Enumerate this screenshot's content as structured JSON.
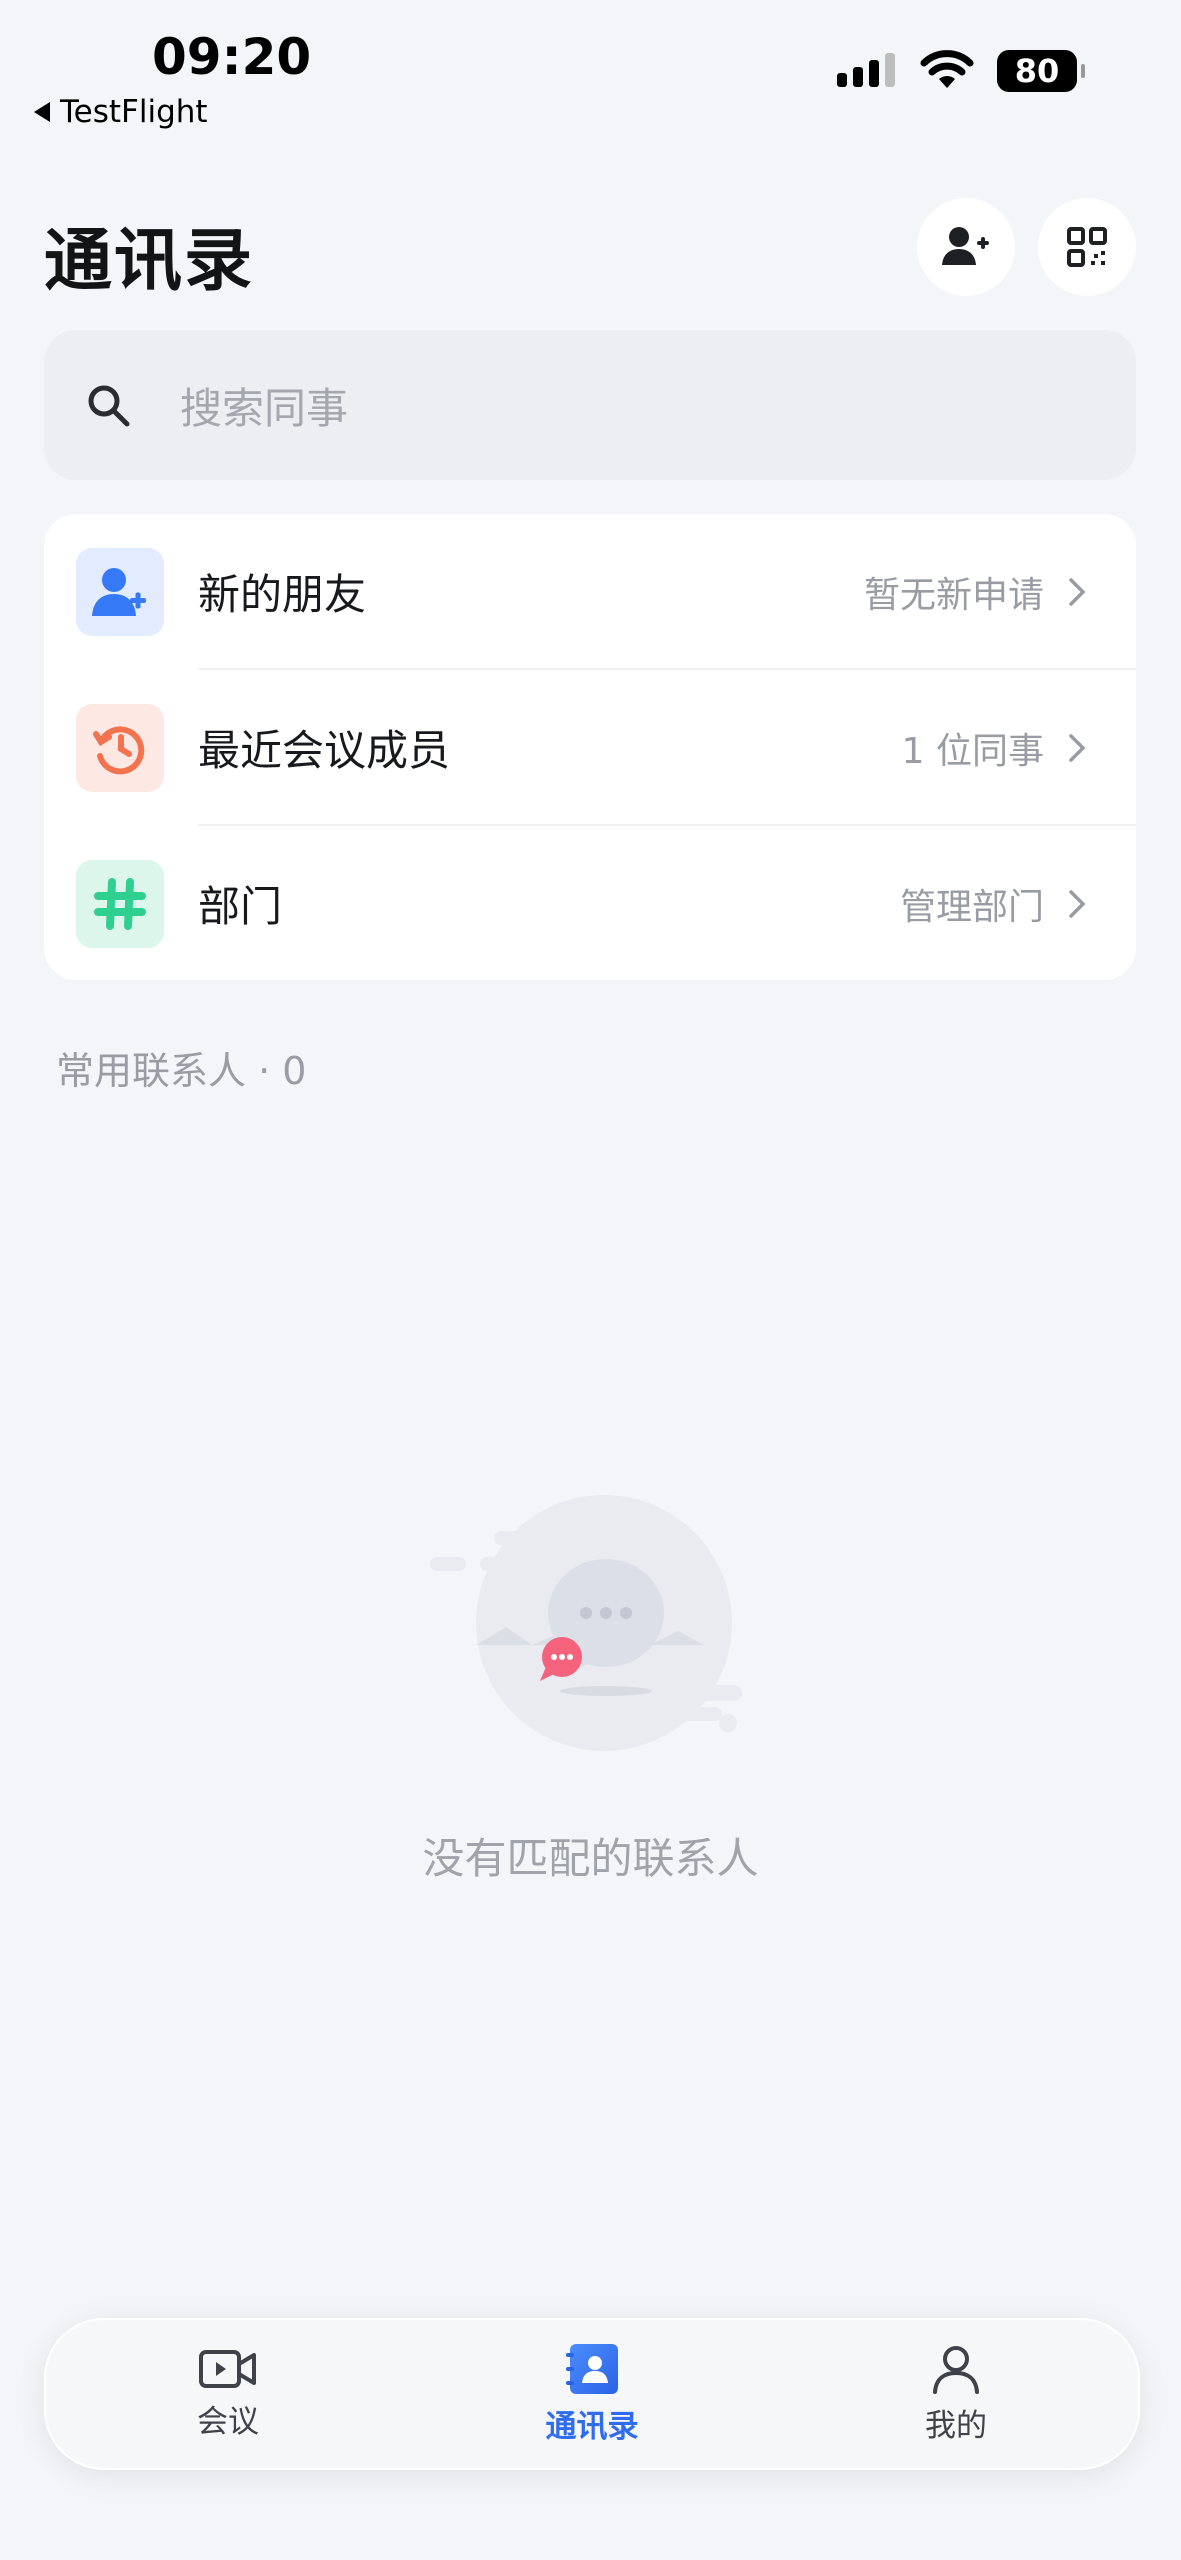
{
  "status_bar": {
    "time": "09:20",
    "back_app": "TestFlight",
    "battery": "80"
  },
  "header": {
    "title": "通讯录"
  },
  "search": {
    "placeholder": "搜索同事"
  },
  "menu": {
    "items": [
      {
        "label": "新的朋友",
        "detail": "暂无新申请",
        "icon": "add-friend-icon",
        "color": "#3579f6"
      },
      {
        "label": "最近会议成员",
        "detail": "1 位同事",
        "icon": "history-clock-icon",
        "color": "#f2734e"
      },
      {
        "label": "部门",
        "detail": "管理部门",
        "icon": "hashtag-icon",
        "color": "#2fcf91"
      }
    ]
  },
  "favorites": {
    "label": "常用联系人 · 0"
  },
  "empty_state": {
    "message": "没有匹配的联系人"
  },
  "tab_bar": {
    "tabs": [
      {
        "label": "会议",
        "icon": "video-camera-icon",
        "active": false
      },
      {
        "label": "通讯录",
        "icon": "contacts-book-icon",
        "active": true
      },
      {
        "label": "我的",
        "icon": "person-icon",
        "active": false
      }
    ],
    "active_color": "#2f6cf0"
  }
}
